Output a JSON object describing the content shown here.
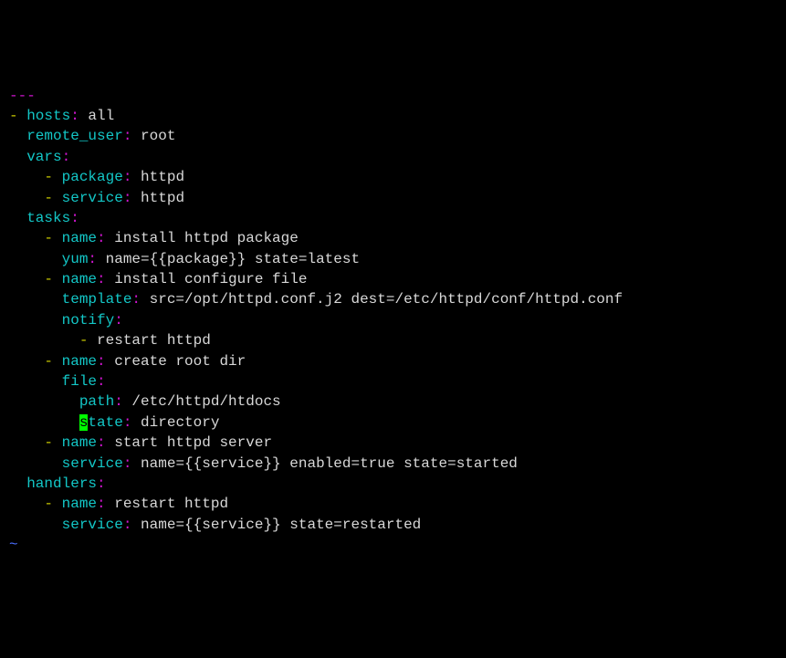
{
  "lines": {
    "l0": "---",
    "l1_dash": "- ",
    "l1_key": "hosts",
    "l1_colon": ": ",
    "l1_val": "all",
    "l2_indent": "  ",
    "l2_key": "remote_user",
    "l2_colon": ": ",
    "l2_val": "root",
    "l3_indent": "  ",
    "l3_key": "vars",
    "l3_colon": ":",
    "l4_indent": "    ",
    "l4_dash": "- ",
    "l4_key": "package",
    "l4_colon": ": ",
    "l4_val": "httpd",
    "l5_indent": "    ",
    "l5_dash": "- ",
    "l5_key": "service",
    "l5_colon": ": ",
    "l5_val": "httpd",
    "l6_indent": "  ",
    "l6_key": "tasks",
    "l6_colon": ":",
    "l7_indent": "    ",
    "l7_dash": "- ",
    "l7_key": "name",
    "l7_colon": ": ",
    "l7_val": "install httpd package",
    "l8_indent": "      ",
    "l8_key": "yum",
    "l8_colon": ": ",
    "l8_val": "name={{package}} state=latest",
    "l9_indent": "    ",
    "l9_dash": "- ",
    "l9_key": "name",
    "l9_colon": ": ",
    "l9_val": "install configure file",
    "l10_indent": "      ",
    "l10_key": "template",
    "l10_colon": ": ",
    "l10_val": "src=/opt/httpd.conf.j2 dest=/etc/httpd/conf/httpd.conf",
    "l11_indent": "      ",
    "l11_key": "notify",
    "l11_colon": ":",
    "l12_indent": "        ",
    "l12_dash": "- ",
    "l12_val": "restart httpd",
    "l13_indent": "    ",
    "l13_dash": "- ",
    "l13_key": "name",
    "l13_colon": ": ",
    "l13_val": "create root dir",
    "l14_indent": "      ",
    "l14_key": "file",
    "l14_colon": ":",
    "l15_indent": "        ",
    "l15_key": "path",
    "l15_colon": ": ",
    "l15_val": "/etc/httpd/htdocs",
    "l16_indent": "        ",
    "l16_cursor": "s",
    "l16_key": "tate",
    "l16_colon": ": ",
    "l16_val": "directory",
    "l17_indent": "    ",
    "l17_dash": "- ",
    "l17_key": "name",
    "l17_colon": ": ",
    "l17_val": "start httpd server",
    "l18_indent": "      ",
    "l18_key": "service",
    "l18_colon": ": ",
    "l18_val": "name={{service}} enabled=true state=started",
    "l19_indent": "  ",
    "l19_key": "handlers",
    "l19_colon": ":",
    "l20_indent": "    ",
    "l20_dash": "- ",
    "l20_key": "name",
    "l20_colon": ": ",
    "l20_val": "restart httpd",
    "l21_indent": "      ",
    "l21_key": "service",
    "l21_colon": ": ",
    "l21_val": "name={{service}} state=restarted",
    "tilde": "~"
  }
}
